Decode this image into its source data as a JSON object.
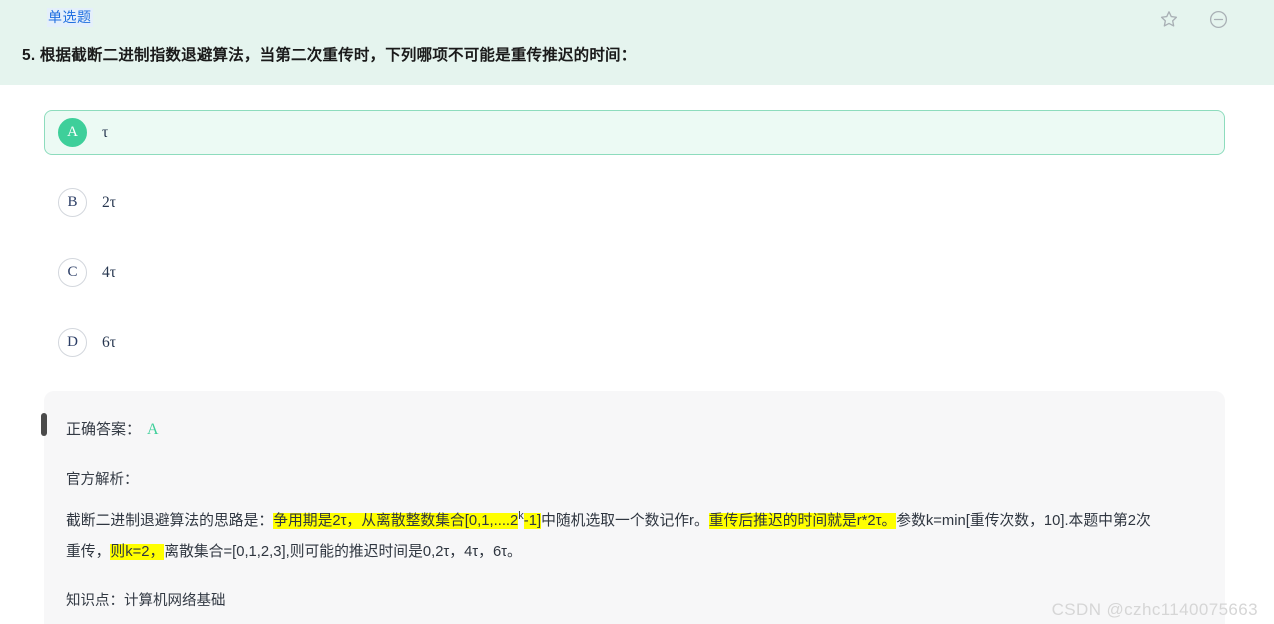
{
  "header": {
    "type_tag": "单选题",
    "icons": [
      {
        "name": "star-icon",
        "title": "收藏"
      },
      {
        "name": "minus-circle-icon",
        "title": "折叠"
      }
    ]
  },
  "question": {
    "number": "5.",
    "text": "5. 根据截断二进制指数退避算法，当第二次重传时，下列哪项不可能是重传推迟的时间："
  },
  "options": [
    {
      "letter": "A",
      "text": "τ",
      "selected": true
    },
    {
      "letter": "B",
      "text": "2τ",
      "selected": false
    },
    {
      "letter": "C",
      "text": "4τ",
      "selected": false
    },
    {
      "letter": "D",
      "text": "6τ",
      "selected": false
    }
  ],
  "explanation": {
    "answer_label": "正确答案：",
    "answer_value": "A",
    "analysis_label": "官方解析：",
    "analysis_segments": [
      {
        "text": "截断二进制退避算法的思路是：",
        "highlight": false,
        "sup": false
      },
      {
        "text": "争用期是2τ，从离散整数集合[0,1,....2",
        "highlight": true,
        "sup": false
      },
      {
        "text": "k",
        "highlight": false,
        "sup": true
      },
      {
        "text": "-1]",
        "highlight": true,
        "sup": false
      },
      {
        "text": "中随机选取一个数记作r。",
        "highlight": false,
        "sup": false
      },
      {
        "text": "重传后推迟的时间就是r*2τ。",
        "highlight": true,
        "sup": false
      },
      {
        "text": "参数k=min[重传次数，10].本题中第2次重传，",
        "highlight": false,
        "sup": false
      },
      {
        "text": "则k=2，",
        "highlight": true,
        "sup": false
      },
      {
        "text": "离散集合=[0,1,2,3],则可能的推迟时间是0,2τ，4τ，6τ。",
        "highlight": false,
        "sup": false
      }
    ],
    "knowledge_label": "知识点：",
    "knowledge_value": "计算机网络基础"
  },
  "watermark": "CSDN @czhc1140075663",
  "colors": {
    "header_bg": "#e5f4ee",
    "accent_green": "#3ecf9a",
    "selected_option_bg": "#ecfaf4",
    "selected_option_border": "#8ddcbd",
    "tag_text": "#1f6fe0",
    "tag_bg": "#e4effb",
    "panel_bg": "#f7f7f8",
    "highlight": "#ffff00",
    "watermark": "#d6d6d6"
  }
}
